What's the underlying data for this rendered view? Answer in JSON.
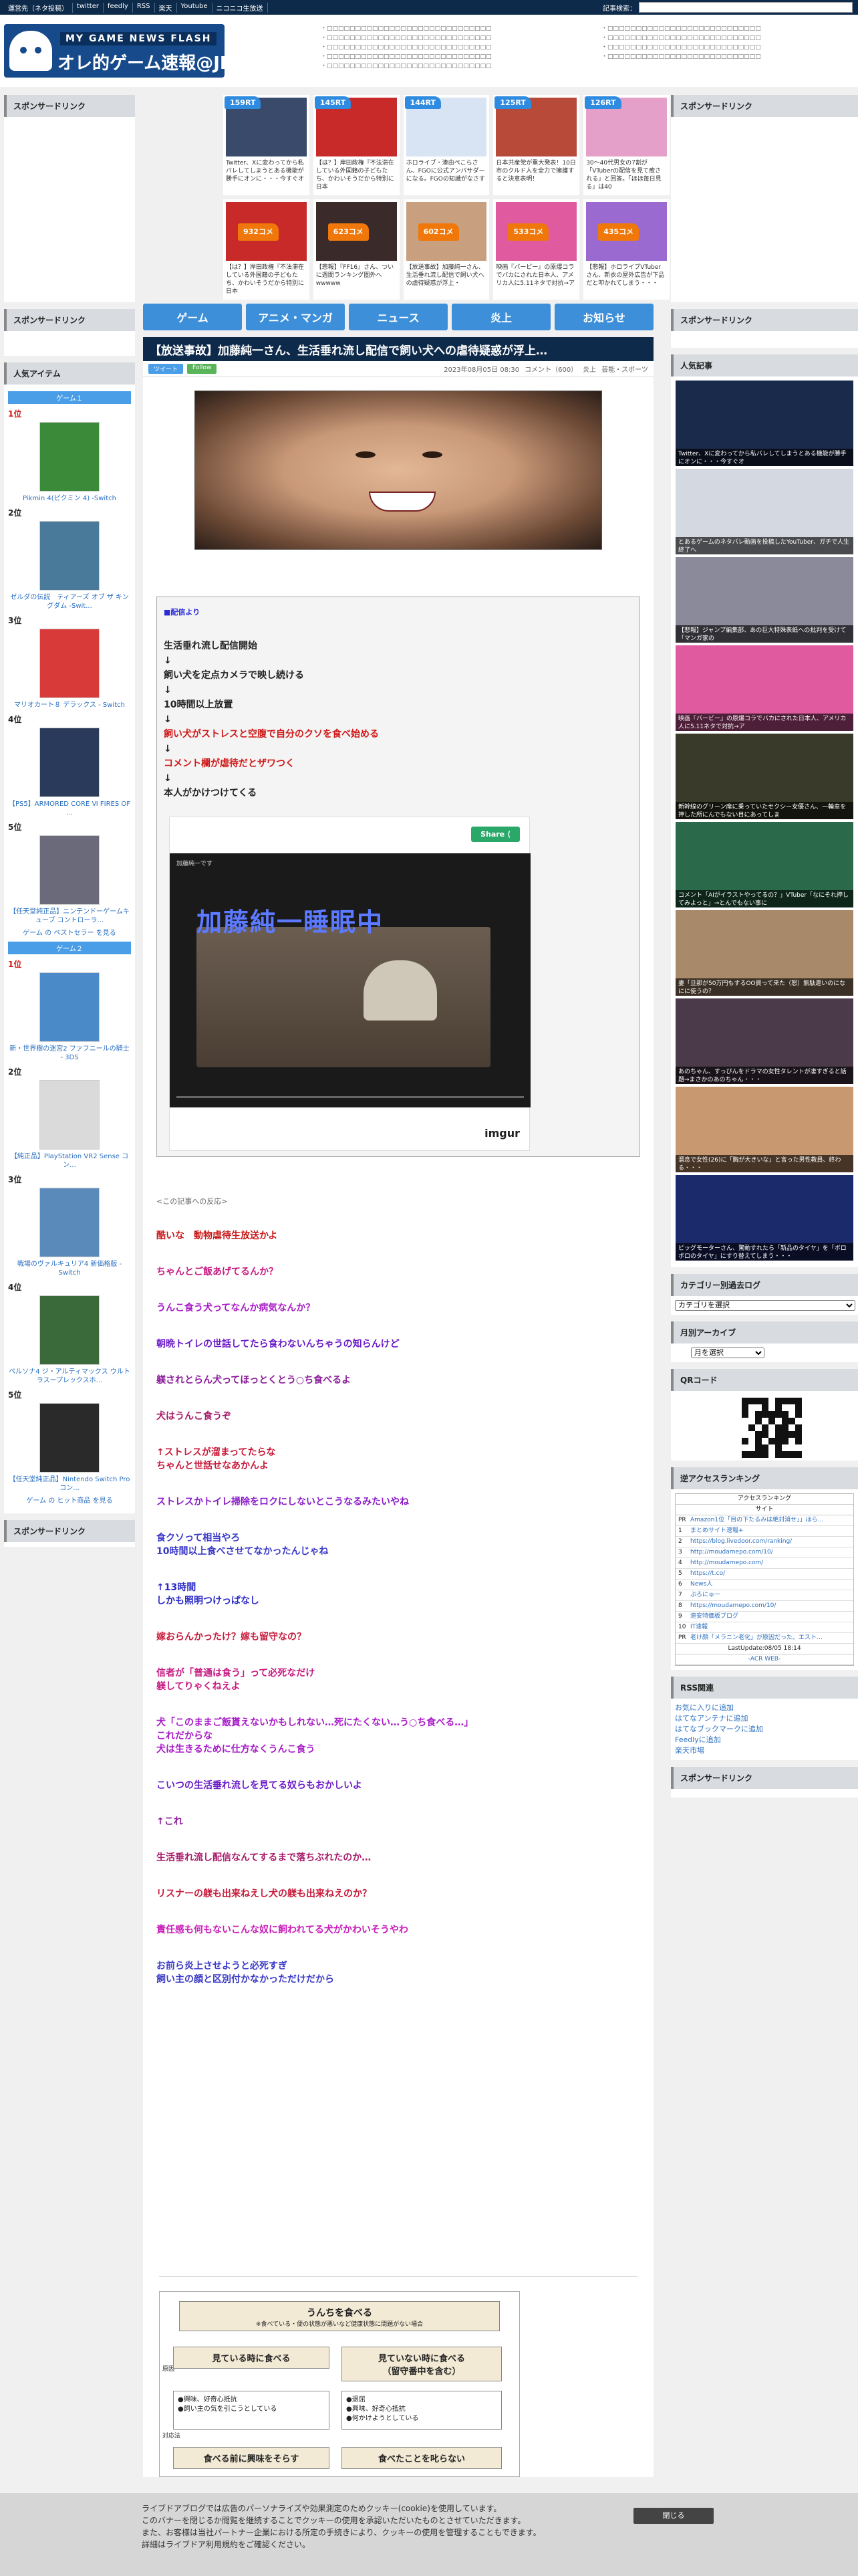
{
  "topbar": {
    "links": [
      "運営先（ネタ投稿）",
      "twitter",
      "feedly",
      "RSS",
      "楽天",
      "Youtube",
      "ニコニコ生放送"
    ],
    "search_label": "記事検索：",
    "search_placeholder": ""
  },
  "header": {
    "logo_sub": "MY GAME NEWS FLASH",
    "logo_title": "オレ的ゲーム速報@JIN",
    "links_a": [
      "・□□□□□□□□□□□□□□□□□□□□□□□□□□□□□",
      "・□□□□□□□□□□□□□□□□□□□□□□□□□□□□□",
      "・□□□□□□□□□□□□□□□□□□□□□□□□□□□□□",
      "・□□□□□□□□□□□□□□□□□□□□□□□□□□□□□",
      "・□□□□□□□□□□□□□□□□□□□□□□□□□□□□□"
    ],
    "links_b": [
      "・□□□□□□□□□□□□□□□□□□□□□□□□□□□",
      "・□□□□□□□□□□□□□□□□□□□□□□□□□□□",
      "・□□□□□□□□□□□□□□□□□□□□□□□□□□□",
      "・□□□□□□□□□□□□□□□□□□□□□□□□□□□"
    ]
  },
  "sponsored": "スポンサードリンク",
  "top_cards": [
    {
      "badge": "159RT",
      "type": "rt",
      "text": "Twitter、Xに変わってから私バレしてしまうとある機能が勝手にオンに・・・今すぐオ",
      "color": "#3a4a6a"
    },
    {
      "badge": "145RT",
      "type": "rt",
      "text": "【は？】岸田政権『不法滞在している外国籍の子どもたち、かわいそうだから特別に日本",
      "color": "#c82a2a"
    },
    {
      "badge": "144RT",
      "type": "rt",
      "text": "ホロライブ・湊由ぺこらさん、FGOに公式アンバサダーになる。FGOの知識がなさす",
      "color": "#d8e4f4"
    },
    {
      "badge": "125RT",
      "type": "rt",
      "text": "日本共産党が重大発表！10日市のクルド人を全力で擁護すると決意表明！",
      "color": "#b84a3a"
    },
    {
      "badge": "126RT",
      "type": "rt",
      "text": "30～40代男女の7割が「VTuberの配信を見て癒される」と回答。「ほほ毎日見る」は40",
      "color": "#e4a0c8"
    },
    {
      "badge": "932コメ",
      "type": "cm",
      "text": "【は？】岸田政権『不法滞在している外国籍の子どもたち、かわいそうだから特別に日本",
      "color": "#c82a2a"
    },
    {
      "badge": "623コメ",
      "type": "cm",
      "text": "【悲報】『FF16』さん、ついに週間ランキング圏外へwwwww",
      "color": "#3a2a2a"
    },
    {
      "badge": "602コメ",
      "type": "cm",
      "text": "【放送事故】加藤純一さん、生活垂れ流し配信で飼い犬への虐待疑惑が浮上・",
      "color": "#c8a080"
    },
    {
      "badge": "533コメ",
      "type": "cm",
      "text": "映画『バービー』の原爆コラでバカにされた日本人、アメリカ人に5.11ネタで対抗→ア",
      "color": "#e05aa0"
    },
    {
      "badge": "435コメ",
      "type": "cm",
      "text": "【悲報】ホロライブVTuberさん、新衣の屋外広告が下品だと叩かれてしまう・・・",
      "color": "#9a6ad0"
    }
  ],
  "nav": [
    "ゲーム",
    "アニメ・マンガ",
    "ニュース",
    "炎上",
    "お知らせ"
  ],
  "article": {
    "title": "【放送事故】加藤純一さん、生活垂れ流し配信で飼い犬への虐待疑惑が浮上…",
    "tw_label": "ツイート",
    "fb_label": "Follow",
    "meta": [
      "2023年08月05日 08:30",
      "コメント（600）",
      "炎上",
      "芸能・スポーツ"
    ],
    "quote_src": "■配信より",
    "quote_lines": [
      {
        "t": "生活垂れ流し配信開始",
        "red": false
      },
      {
        "t": "↓",
        "red": false
      },
      {
        "t": "飼い犬を定点カメラで映し続ける",
        "red": false
      },
      {
        "t": "↓",
        "red": false
      },
      {
        "t": "10時間以上放置",
        "red": false
      },
      {
        "t": "↓",
        "red": false
      },
      {
        "t": "飼い犬がストレスと空腹で自分のクソを食べ始める",
        "red": true
      },
      {
        "t": "↓",
        "red": false
      },
      {
        "t": "コメント欄が虐待だとザワつく",
        "red": true
      },
      {
        "t": "↓",
        "red": false
      },
      {
        "t": "本人がかけつけてくる",
        "red": false
      }
    ],
    "imgur": {
      "share": "Share",
      "overlay": "加藤純一睡眠中",
      "logo": "imgur",
      "channel": "加藤純一です"
    },
    "reaction_label": "<この記事への反応>",
    "comments": [
      {
        "t": "酷いな　動物虐待生放送かよ",
        "c": "#c81a1a"
      },
      {
        "t": "ちゃんとご飯あげてるんか？",
        "c": "#c81a82"
      },
      {
        "t": "うんこ食う犬ってなんか病気なんか？",
        "c": "#a81ac8"
      },
      {
        "t": "朝晩トイレの世話してたら食わないんちゃうの知らんけど",
        "c": "#6a1ac8"
      },
      {
        "t": "躾されとらん犬ってほっとくとう○ち食べるよ",
        "c": "#8a1a9a"
      },
      {
        "t": "犬はうんこ食うぞ",
        "c": "#a81a6a"
      },
      {
        "t": "↑ストレスが溜まってたらな\nちゃんと世話せなあかんよ",
        "c": "#c81a3a"
      },
      {
        "t": "ストレスかトイレ掃除をロクにしないとこうなるみたいやね",
        "c": "#8a1ac8"
      },
      {
        "t": "食クソって相当やろ\n10時間以上食べさせてなかったんじゃね",
        "c": "#3a3ac8"
      },
      {
        "t": "↑13時間\nしかも照明つけっぱなし",
        "c": "#2a2ac8"
      },
      {
        "t": "嫁おらんかったけ？嫁も留守なの？",
        "c": "#c81a3a"
      },
      {
        "t": "信者が「普通は食う」って必死なだけ\n躾してりゃくねえよ",
        "c": "#c81a82"
      },
      {
        "t": "犬「このままご飯貰えないかもしれない…死にたくない…う○ち食べる…」\nこれだからな\n犬は生きるために仕方なくうんこ食う",
        "c": "#a81ac8"
      },
      {
        "t": "こいつの生活垂れ流しを見てる奴らもおかしいよ",
        "c": "#6a1ac8"
      },
      {
        "t": "↑これ",
        "c": "#8a1a9a"
      },
      {
        "t": "生活垂れ流し配信なんてするまで落ちぶれたのか…",
        "c": "#a81a6a"
      },
      {
        "t": "リスナーの躾も出来ねえし犬の躾も出来ねえのか？",
        "c": "#c81a3a"
      },
      {
        "t": "責任感も何もないこんな奴に飼われてる犬がかわいそうやわ",
        "c": "#c81ab8"
      },
      {
        "t": "お前ら炎上させようと必死すぎ\n飼い主の顔と区別付かなかっただけだから",
        "c": "#3a3ac8"
      }
    ],
    "chart": {
      "title": "うんちを食べる",
      "sub": "※食べている・便の状態が悪いなど健康状態に問題がない場合",
      "b1": "見ている時に食べる",
      "b2": "見ていない時に食べる\n（留守番中を含む）",
      "w1": "●興味、好奇心抵抗\n●飼い主の気を引こうとしている",
      "w2": "●退屈\n●興味、好奇心抵抗\n●何かけようとしている",
      "b3": "食べる前に興味をそらす",
      "b4": "食べたことを叱らない",
      "side1": "原因",
      "side2": "対応法"
    }
  },
  "left": {
    "popular_head": "人気アイテム",
    "game1_head": "ゲーム１",
    "game1": [
      {
        "rank": "1位",
        "t": "Pikmin 4(ピクミン 4) -Switch",
        "c": "#3a8a3a"
      },
      {
        "rank": "2位",
        "t": "ゼルダの伝説　ティアーズ オブ ザ キングダム -Swit...",
        "c": "#4a7a9a"
      },
      {
        "rank": "3位",
        "t": "マリオカート８ デラックス - Switch",
        "c": "#d83a3a"
      },
      {
        "rank": "4位",
        "t": "【PS5】ARMORED CORE Ⅵ FIRES OF ...",
        "c": "#2a3a5a"
      },
      {
        "rank": "5位",
        "t": "【任天堂純正品】ニンテンドーゲームキューブ コントローラ...",
        "c": "#6a6a7a"
      }
    ],
    "game1_more": "ゲーム の ベストセラー を見る",
    "game2_head": "ゲーム２",
    "game2": [
      {
        "rank": "1位",
        "t": "新・世界樹の迷宮2 ファフニールの騎士 - 3DS",
        "c": "#4a8ac8"
      },
      {
        "rank": "2位",
        "t": "【純正品】PlayStation VR2 Sense コン...",
        "c": "#dadada"
      },
      {
        "rank": "3位",
        "t": "戦場のヴァルキュリア4 新価格版 - Switch",
        "c": "#5a8aba"
      },
      {
        "rank": "4位",
        "t": "ペルソナ4 ジ・アルティマックス ウルトラスープレックスホ...",
        "c": "#3a6a3a"
      },
      {
        "rank": "5位",
        "t": "【任天堂純正品】Nintendo Switch Proコン...",
        "c": "#2a2a2a"
      }
    ],
    "game2_more": "ゲーム の ヒット商品 を見る"
  },
  "right": {
    "popular_head": "人気記事",
    "popular": [
      {
        "t": "Twitter、Xに変わってから私バレしてしまうとある機能が勝手にオンに・・・今すぐオ",
        "c": "#1a2a4a"
      },
      {
        "t": "とあるゲームのネタバレ動画を投稿したYouTuber、ガチで人生終了へ",
        "c": "#d4d8e0"
      },
      {
        "t": "【悲報】ジャンプ編集部、あの巨大特殊表紙への批判を受けて「マンガ家の",
        "c": "#8a8a9a"
      },
      {
        "t": "映画『バービー』の原爆コラでバカにされた日本人、アメリカ人に5.11ネタで対抗→ア",
        "c": "#e05aa0"
      },
      {
        "t": "新幹線のグリーン席に乗っていたセクシー女優さん、一輪車を押した所にんでもない目にあってしま",
        "c": "#3a3a2a"
      },
      {
        "t": "コメント「AIがイラストやってるの？」VTuber「なにそれ押してみよっと」→とんでもない事に",
        "c": "#2a6a4a"
      },
      {
        "t": "妻「旦那が50万円もするOO買って来た（怒）無駄遣いのになにに使うの？",
        "c": "#a88a6a"
      },
      {
        "t": "あのちゃん、すっぴんをドラマの女性タレントが凄すぎると話題→まさかのあのちゃん・・・",
        "c": "#4a3a4a"
      },
      {
        "t": "溜息で女性(26)に「胸が大きいな」と言った男性教員、終わる・・・",
        "c": "#c89870"
      },
      {
        "t": "ピッグモーターさん、驚動すれたら「新品のタイヤ」を「ボロボロのタイヤ」にすり替えてしまう・・・",
        "c": "#1a2a6a"
      }
    ],
    "cat_head": "カテゴリー別過去ログ",
    "cat_select": "カテゴリを選択",
    "month_head": "月別アーカイブ",
    "month_select": "月を選択",
    "qr_head": "QRコード",
    "rank_head": "逆アクセスランキング",
    "rank_title": "アクセスランキング",
    "rank_sub": "サイト",
    "rank_rows": [
      {
        "n": "PR",
        "t": "Amazon1位「目の下たるみは絶対消せ」」ほら…"
      },
      {
        "n": "1",
        "t": "まとめサイト速報+"
      },
      {
        "n": "2",
        "t": "https://blog.livedoor.com/ranking/"
      },
      {
        "n": "3",
        "t": "http://moudamepo.com/10/"
      },
      {
        "n": "4",
        "t": "http://moudamepo.com/"
      },
      {
        "n": "5",
        "t": "https://t.co/"
      },
      {
        "n": "6",
        "t": "News人"
      },
      {
        "n": "7",
        "t": "ぷろにゅー"
      },
      {
        "n": "8",
        "t": "https://moudamepo.com/10/"
      },
      {
        "n": "9",
        "t": "速安特価板ブログ"
      },
      {
        "n": "10",
        "t": "IT速報"
      },
      {
        "n": "PR",
        "t": "老け顔「メラニン老化」が原因だった。エスト…"
      }
    ],
    "rank_update": "LastUpdate:08/05 18:14",
    "rank_footer": "-ACR WEB-",
    "rss_head": "RSS関連",
    "rss_links": [
      "お気に入りに追加",
      "はてなアンテナに追加",
      "はてなブックマークに追加",
      "Feedlyに追加",
      "楽天市場"
    ]
  },
  "cookie": {
    "lines": [
      "ライブドアブログでは広告のパーソナライズや効果測定のためクッキー(cookie)を使用しています。",
      "このバナーを閉じるか閲覧を継続することでクッキーの使用を承認いただいたものとさせていただきます。",
      "また、お客様は当社パートナー企業における所定の手続きにより、クッキーの使用を管理することもできます。",
      "詳細はライブドア利用規約をご確認ください。"
    ],
    "close": "閉じる"
  }
}
